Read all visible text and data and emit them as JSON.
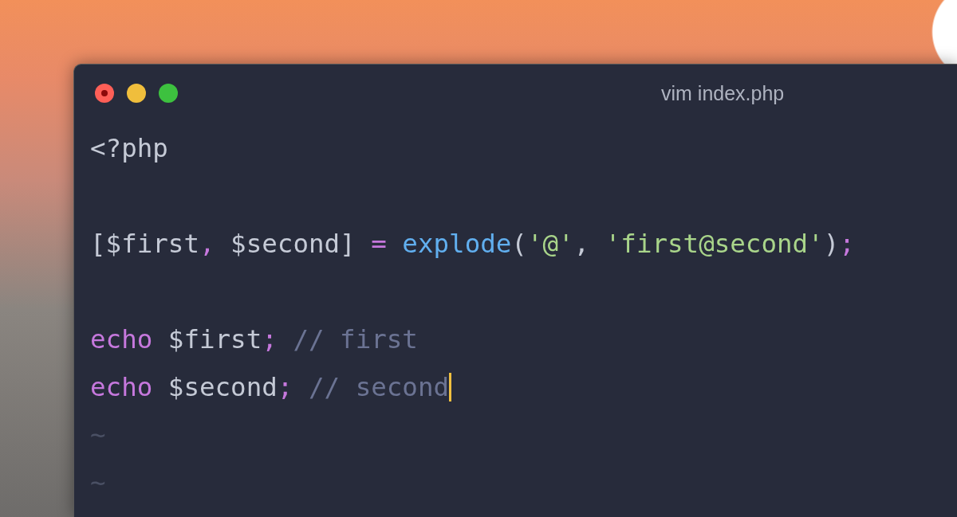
{
  "window": {
    "title": "vim index.php"
  },
  "lines": [
    {
      "kind": "code",
      "cursor": false,
      "tokens": [
        {
          "kind": "plain",
          "text": "<?php"
        }
      ]
    },
    {
      "kind": "blank"
    },
    {
      "kind": "code",
      "cursor": false,
      "tokens": [
        {
          "kind": "plain",
          "text": "[$first"
        },
        {
          "kind": "punct",
          "text": ","
        },
        {
          "kind": "plain",
          "text": " $second]"
        },
        {
          "kind": "punct",
          "text": " = "
        },
        {
          "kind": "function",
          "text": "explode"
        },
        {
          "kind": "plain",
          "text": "("
        },
        {
          "kind": "string",
          "text": "'@'"
        },
        {
          "kind": "plain",
          "text": ", "
        },
        {
          "kind": "string",
          "text": "'first@second'"
        },
        {
          "kind": "plain",
          "text": ")"
        },
        {
          "kind": "punct",
          "text": ";"
        }
      ]
    },
    {
      "kind": "blank"
    },
    {
      "kind": "code",
      "cursor": false,
      "tokens": [
        {
          "kind": "keyword",
          "text": "echo"
        },
        {
          "kind": "plain",
          "text": " $first"
        },
        {
          "kind": "punct",
          "text": ";"
        },
        {
          "kind": "comment",
          "text": " // first"
        }
      ]
    },
    {
      "kind": "code",
      "cursor": true,
      "tokens": [
        {
          "kind": "keyword",
          "text": "echo"
        },
        {
          "kind": "plain",
          "text": " $second"
        },
        {
          "kind": "punct",
          "text": ";"
        },
        {
          "kind": "comment",
          "text": " // second"
        }
      ]
    },
    {
      "kind": "tilde",
      "text": "~"
    },
    {
      "kind": "tilde",
      "text": "~"
    }
  ]
}
